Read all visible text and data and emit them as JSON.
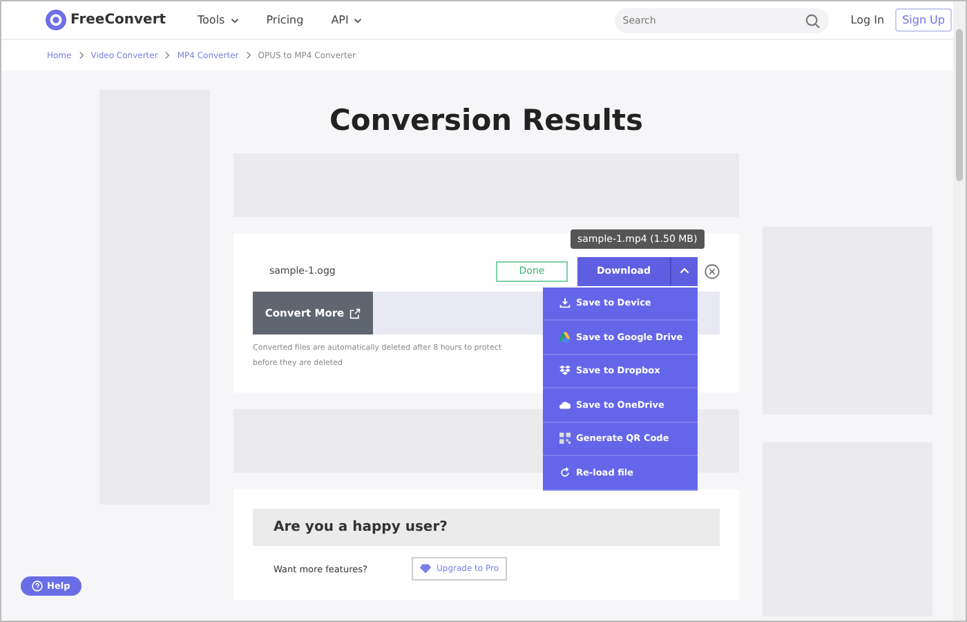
{
  "header": {
    "logo": "FreeConvert",
    "nav": [
      {
        "label": "Tools",
        "dropdown": true
      },
      {
        "label": "Pricing",
        "dropdown": false
      },
      {
        "label": "API",
        "dropdown": true
      }
    ],
    "search": {
      "placeholder": "Search"
    },
    "login": "Log In",
    "signup": "Sign Up"
  },
  "breadcrumb": [
    {
      "label": "Home",
      "current": false
    },
    {
      "label": "Video Converter",
      "current": false
    },
    {
      "label": "MP4 Converter",
      "current": false
    },
    {
      "label": "OPUS to MP4 Converter",
      "current": true
    }
  ],
  "title": "Conversion Results",
  "file": {
    "name": "sample-1.ogg",
    "status": "Done",
    "download": "Download",
    "tooltip": "sample-1.mp4 (1.50 MB)",
    "menu_expanded": true
  },
  "convert_more": "Convert More",
  "note": "Converted files are automatically deleted after 8 hours to protect",
  "note_line2": "before they are deleted",
  "menu": [
    {
      "label": "Save to Device",
      "kind": "device"
    },
    {
      "label": "Save to Google Drive",
      "kind": "gdrive"
    },
    {
      "label": "Save to Dropbox",
      "kind": "dropbox"
    },
    {
      "label": "Save to OneDrive",
      "kind": "onedrive"
    },
    {
      "label": "Generate QR Code",
      "kind": "qr"
    },
    {
      "label": "Re-load file",
      "kind": "reload"
    }
  ],
  "happy": {
    "title": "Are you a happy user?",
    "prompt": "Want more features?",
    "upgrade": "Upgrade to Pro"
  },
  "help": "Help"
}
